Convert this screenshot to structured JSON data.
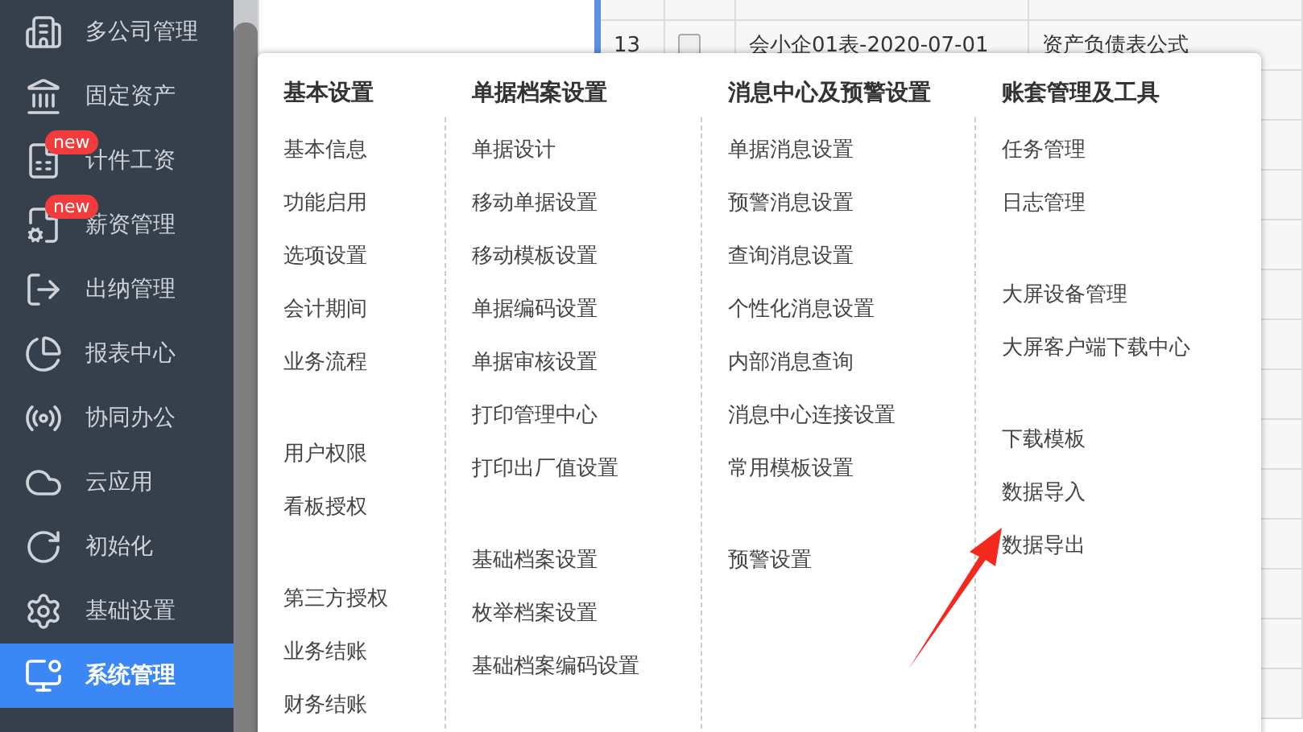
{
  "sidebar": {
    "items": [
      {
        "label": "多公司管理",
        "selected": false
      },
      {
        "label": "固定资产",
        "selected": false
      },
      {
        "label": "计件工资",
        "selected": false,
        "badge": "new"
      },
      {
        "label": "薪资管理",
        "selected": false,
        "badge": "new"
      },
      {
        "label": "出纳管理",
        "selected": false
      },
      {
        "label": "报表中心",
        "selected": false
      },
      {
        "label": "协同办公",
        "selected": false
      },
      {
        "label": "云应用",
        "selected": false
      },
      {
        "label": "初始化",
        "selected": false
      },
      {
        "label": "基础设置",
        "selected": false
      },
      {
        "label": "系统管理",
        "selected": true
      }
    ]
  },
  "table": {
    "rows": [
      {
        "number": "13",
        "checked": false,
        "name": "会小企01表-2020-07-01",
        "formula": "资产负债表公式"
      }
    ]
  },
  "menu": {
    "columns": [
      {
        "heading": "基本设置",
        "groups": [
          [
            "基本信息",
            "功能启用",
            "选项设置",
            "会计期间",
            "业务流程"
          ],
          [
            "用户权限",
            "看板授权"
          ],
          [
            "第三方授权",
            "业务结账",
            "财务结账"
          ]
        ]
      },
      {
        "heading": "单据档案设置",
        "groups": [
          [
            "单据设计",
            "移动单据设置",
            "移动模板设置",
            "单据编码设置",
            "单据审核设置",
            "打印管理中心",
            "打印出厂值设置"
          ],
          [
            "基础档案设置",
            "枚举档案设置",
            "基础档案编码设置"
          ]
        ]
      },
      {
        "heading": "消息中心及预警设置",
        "groups": [
          [
            "单据消息设置",
            "预警消息设置",
            "查询消息设置",
            "个性化消息设置",
            "内部消息查询",
            "消息中心连接设置",
            "常用模板设置"
          ],
          [
            "预警设置"
          ]
        ]
      },
      {
        "heading": "账套管理及工具",
        "groups": [
          [
            "任务管理",
            "日志管理"
          ],
          [
            "大屏设备管理",
            "大屏客户端下载中心"
          ],
          [
            "下载模板",
            "数据导入",
            "数据导出"
          ]
        ]
      }
    ]
  }
}
